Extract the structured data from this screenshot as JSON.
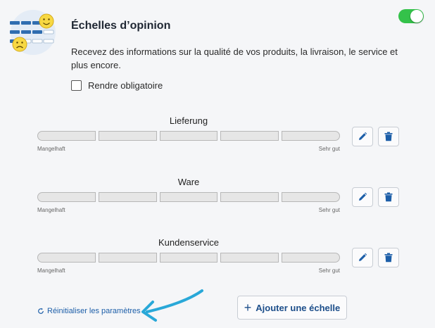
{
  "header": {
    "title": "Échelles d’opinion",
    "description": "Recevez des informations sur la qualité de vos produits, la livraison, le service et plus encore.",
    "required_label": "Rendre obligatoire",
    "enabled": true
  },
  "scales": [
    {
      "title": "Lieferung",
      "low_label": "Mangelhaft",
      "high_label": "Sehr gut"
    },
    {
      "title": "Ware",
      "low_label": "Mangelhaft",
      "high_label": "Sehr gut"
    },
    {
      "title": "Kundenservice",
      "low_label": "Mangelhaft",
      "high_label": "Sehr gut"
    }
  ],
  "footer": {
    "reset_label": "Réinitialiser les paramètres",
    "add_label": "Ajouter une échelle"
  },
  "colors": {
    "toggle_on": "#34c24a",
    "accent": "#1c5ea8",
    "annotation_arrow": "#29a8d8"
  },
  "icons": [
    "opinion-scale-icon",
    "pencil-icon",
    "trash-icon",
    "refresh-icon",
    "plus-icon"
  ]
}
